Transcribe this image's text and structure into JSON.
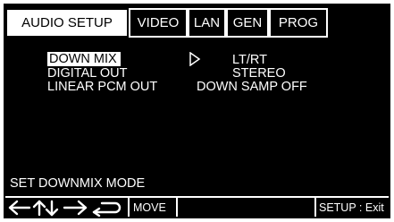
{
  "tabs": [
    {
      "label": "AUDIO SETUP",
      "active": true
    },
    {
      "label": "VIDEO",
      "active": false
    },
    {
      "label": "LAN",
      "active": false
    },
    {
      "label": "GEN",
      "active": false
    },
    {
      "label": "PROG",
      "active": false
    }
  ],
  "menu": {
    "items": [
      {
        "label": "DOWN MIX",
        "value": "LT/RT",
        "selected": true
      },
      {
        "label": "DIGITAL OUT",
        "value": "STEREO",
        "selected": false
      },
      {
        "label": "LINEAR PCM OUT",
        "value": "DOWN SAMP OFF",
        "selected": false
      }
    ]
  },
  "status_text": "SET DOWNMIX MODE",
  "footer": {
    "nav_icons": [
      "left-arrow-icon",
      "up-down-arrow-icon",
      "right-arrow-icon",
      "enter-icon"
    ],
    "move_label": "MOVE",
    "exit_label": "SETUP : Exit"
  },
  "colors": {
    "background": "#000000",
    "foreground": "#ffffff"
  }
}
